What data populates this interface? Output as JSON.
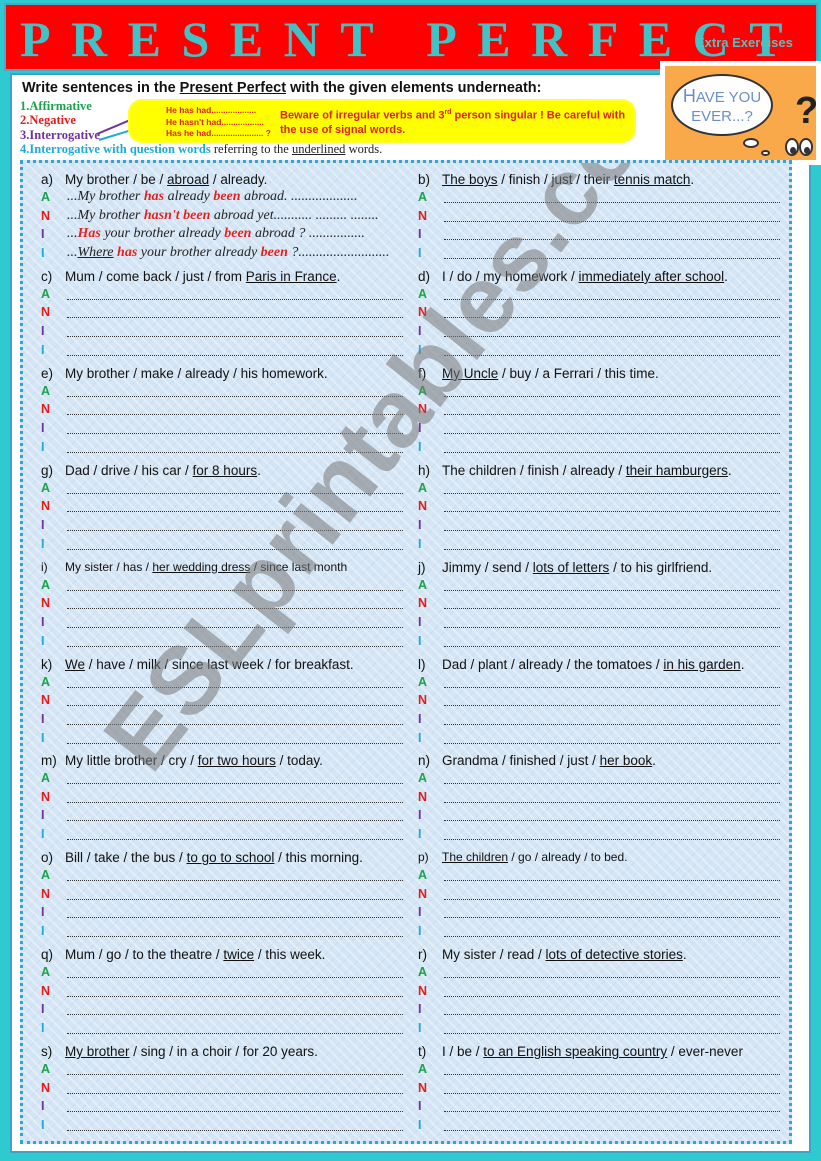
{
  "header": {
    "title": "PRESENT PERFECT",
    "subtitle": "Extra Exercises"
  },
  "instructions": {
    "prefix": "Write sentences in the ",
    "emphasis": "Present Perfect",
    "suffix": " with the given elements underneath:",
    "types": [
      "1.Affirmative",
      "2.Negative",
      "3.Interrogative",
      "4.Interrogative with question words"
    ],
    "type4_rest_prefix": " referring to the ",
    "type4_rest_underlined": "underlined",
    "type4_rest_suffix": " words."
  },
  "callout": {
    "forms": [
      "He has had...................",
      "He hasn't had..................",
      "Has he had...................... ?"
    ],
    "note_part1": "Beware of irregular verbs and 3",
    "note_sup": "rd",
    "note_part2": " person singular !  Be careful with the use of signal words."
  },
  "picture": {
    "bubble_line1_cap": "H",
    "bubble_line1_rest": "AVE YOU",
    "bubble_line2": "EVER...?",
    "mark": "?"
  },
  "watermark": "ESLprintables.com",
  "labels": [
    "A",
    "N",
    "I",
    "I"
  ],
  "example": {
    "answers": [
      {
        "pre": "...My brother ",
        "hl1": "has",
        "mid": " already ",
        "hl2": "been",
        "post": " abroad",
        "dots": ". ..................."
      },
      {
        "pre": "...My brother ",
        "hl1": "hasn't been",
        "mid": "",
        "hl2": "",
        "post": " abroad yet",
        "dots": "........... ......... ........"
      },
      {
        "pre": "...",
        "hl1": "Has",
        "mid": " your brother already ",
        "hl2": "been",
        "post": " abroad ?",
        "dots": " ................"
      },
      {
        "pre": "...",
        "under": "Where",
        "hl1": "has",
        "mid": " your brother already ",
        "hl2": "been",
        "post": " ?",
        "dots": ".........................."
      }
    ]
  },
  "exercises": [
    {
      "letter": "a)",
      "parts": [
        {
          "t": "My brother / be / "
        },
        {
          "t": "abroad",
          "u": true
        },
        {
          "t": " / already."
        }
      ]
    },
    {
      "letter": "b)",
      "parts": [
        {
          "t": "The boys",
          "u": true
        },
        {
          "t": " / finish / just / their "
        },
        {
          "t": "tennis match",
          "u": true
        },
        {
          "t": "."
        }
      ]
    },
    {
      "letter": "c)",
      "parts": [
        {
          "t": "Mum / come back / just / from "
        },
        {
          "t": "Paris in France",
          "u": true
        },
        {
          "t": "."
        }
      ]
    },
    {
      "letter": "d)",
      "parts": [
        {
          "t": "I / do / my homework / "
        },
        {
          "t": "immediately after school",
          "u": true
        },
        {
          "t": "."
        }
      ]
    },
    {
      "letter": "e)",
      "parts": [
        {
          "t": "My brother / make / already / his homework."
        }
      ]
    },
    {
      "letter": "f)",
      "parts": [
        {
          "t": "My Uncle",
          "u": true
        },
        {
          "t": " / buy / a Ferrari / this time."
        }
      ]
    },
    {
      "letter": "g)",
      "parts": [
        {
          "t": "Dad / drive / his car / "
        },
        {
          "t": "for 8 hours",
          "u": true
        },
        {
          "t": "."
        }
      ]
    },
    {
      "letter": "h)",
      "parts": [
        {
          "t": "The children / finish / already /  "
        },
        {
          "t": "their hamburgers",
          "u": true
        },
        {
          "t": "."
        }
      ]
    },
    {
      "letter": "i)",
      "small": true,
      "parts": [
        {
          "t": "My sister / has / "
        },
        {
          "t": "her wedding dress",
          "u": true
        },
        {
          "t": " / since last month"
        }
      ]
    },
    {
      "letter": "j)",
      "parts": [
        {
          "t": "Jimmy / send / "
        },
        {
          "t": "lots of letters",
          "u": true
        },
        {
          "t": " / to his girlfriend."
        }
      ]
    },
    {
      "letter": "k)",
      "parts": [
        {
          "t": "We",
          "u": true
        },
        {
          "t": " / have / milk / since last week / for breakfast."
        }
      ]
    },
    {
      "letter": "l)",
      "parts": [
        {
          "t": "Dad / plant / already / the tomatoes / "
        },
        {
          "t": "in his garden",
          "u": true
        },
        {
          "t": "."
        }
      ]
    },
    {
      "letter": "m)",
      "parts": [
        {
          "t": "My little brother / cry / "
        },
        {
          "t": "for two hours",
          "u": true
        },
        {
          "t": " / today."
        }
      ]
    },
    {
      "letter": "n)",
      "parts": [
        {
          "t": "Grandma / finished / just / "
        },
        {
          "t": "her book",
          "u": true
        },
        {
          "t": "."
        }
      ]
    },
    {
      "letter": "o)",
      "parts": [
        {
          "t": "Bill / take / the bus / "
        },
        {
          "t": "to go to school",
          "u": true
        },
        {
          "t": " / this morning."
        }
      ]
    },
    {
      "letter": "p)",
      "small": true,
      "parts": [
        {
          "t": "The children",
          "u": true
        },
        {
          "t": " / go / already / to bed."
        }
      ]
    },
    {
      "letter": "q)",
      "parts": [
        {
          "t": "Mum / go / to the theatre / "
        },
        {
          "t": "twice",
          "u": true
        },
        {
          "t": " / this week."
        }
      ]
    },
    {
      "letter": "r)",
      "parts": [
        {
          "t": "My sister / read / "
        },
        {
          "t": "lots of detective stories",
          "u": true
        },
        {
          "t": "."
        }
      ]
    },
    {
      "letter": "s)",
      "parts": [
        {
          "t": "My brother",
          "u": true
        },
        {
          "t": " / sing / in a choir /  for 20 years."
        }
      ]
    },
    {
      "letter": "t)",
      "parts": [
        {
          "t": "I / be / "
        },
        {
          "t": "to an English speaking country",
          "u": true
        },
        {
          "t": " / ever-never"
        }
      ]
    }
  ]
}
